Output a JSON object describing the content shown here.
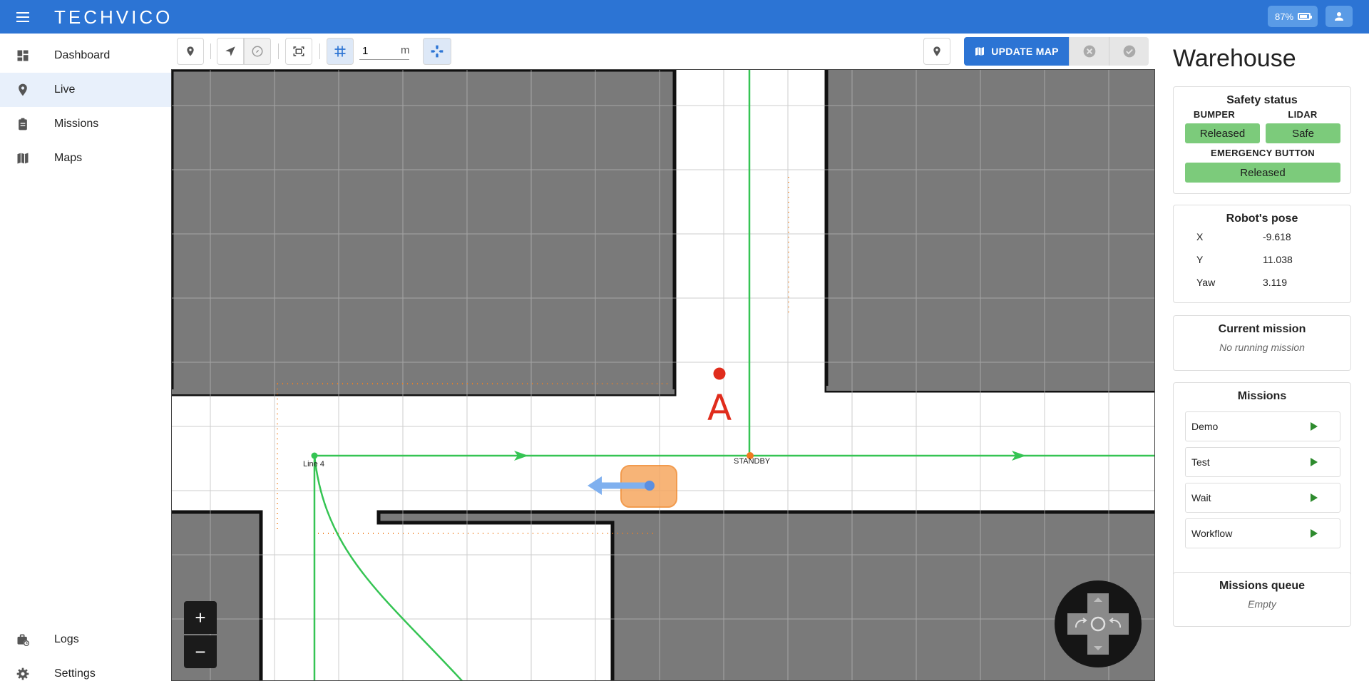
{
  "app": {
    "logo": "TECHVICO",
    "battery": "87%",
    "accent_color": "#2c74d4"
  },
  "sidebar": {
    "items": [
      {
        "label": "Dashboard",
        "icon": "dashboard-icon"
      },
      {
        "label": "Live",
        "icon": "location-pin-icon",
        "active": true
      },
      {
        "label": "Missions",
        "icon": "clipboard-icon"
      },
      {
        "label": "Maps",
        "icon": "map-icon"
      }
    ],
    "bottom_items": [
      {
        "label": "Logs",
        "icon": "logs-icon"
      },
      {
        "label": "Settings",
        "icon": "gear-icon"
      }
    ]
  },
  "toolbar": {
    "grid_value": "1",
    "grid_unit": "m",
    "update_map_label": "UPDATE MAP"
  },
  "map": {
    "waypoints": [
      {
        "label": "Line 4"
      },
      {
        "label": "STANDBY"
      }
    ],
    "marker_label": "A"
  },
  "panel": {
    "title": "Warehouse",
    "safety": {
      "title": "Safety status",
      "bumper_label": "BUMPER",
      "bumper_value": "Released",
      "lidar_label": "LIDAR",
      "lidar_value": "Safe",
      "emergency_label": "EMERGENCY BUTTON",
      "emergency_value": "Released",
      "ok_color": "#7ccb7b"
    },
    "pose": {
      "title": "Robot's pose",
      "rows": [
        {
          "key": "X",
          "value": "-9.618"
        },
        {
          "key": "Y",
          "value": "11.038"
        },
        {
          "key": "Yaw",
          "value": "3.119"
        }
      ]
    },
    "current_mission": {
      "title": "Current mission",
      "value": "No running mission"
    },
    "missions": {
      "title": "Missions",
      "items": [
        "Demo",
        "Test",
        "Wait",
        "Workflow"
      ]
    },
    "queue": {
      "title": "Missions queue",
      "value": "Empty"
    }
  }
}
